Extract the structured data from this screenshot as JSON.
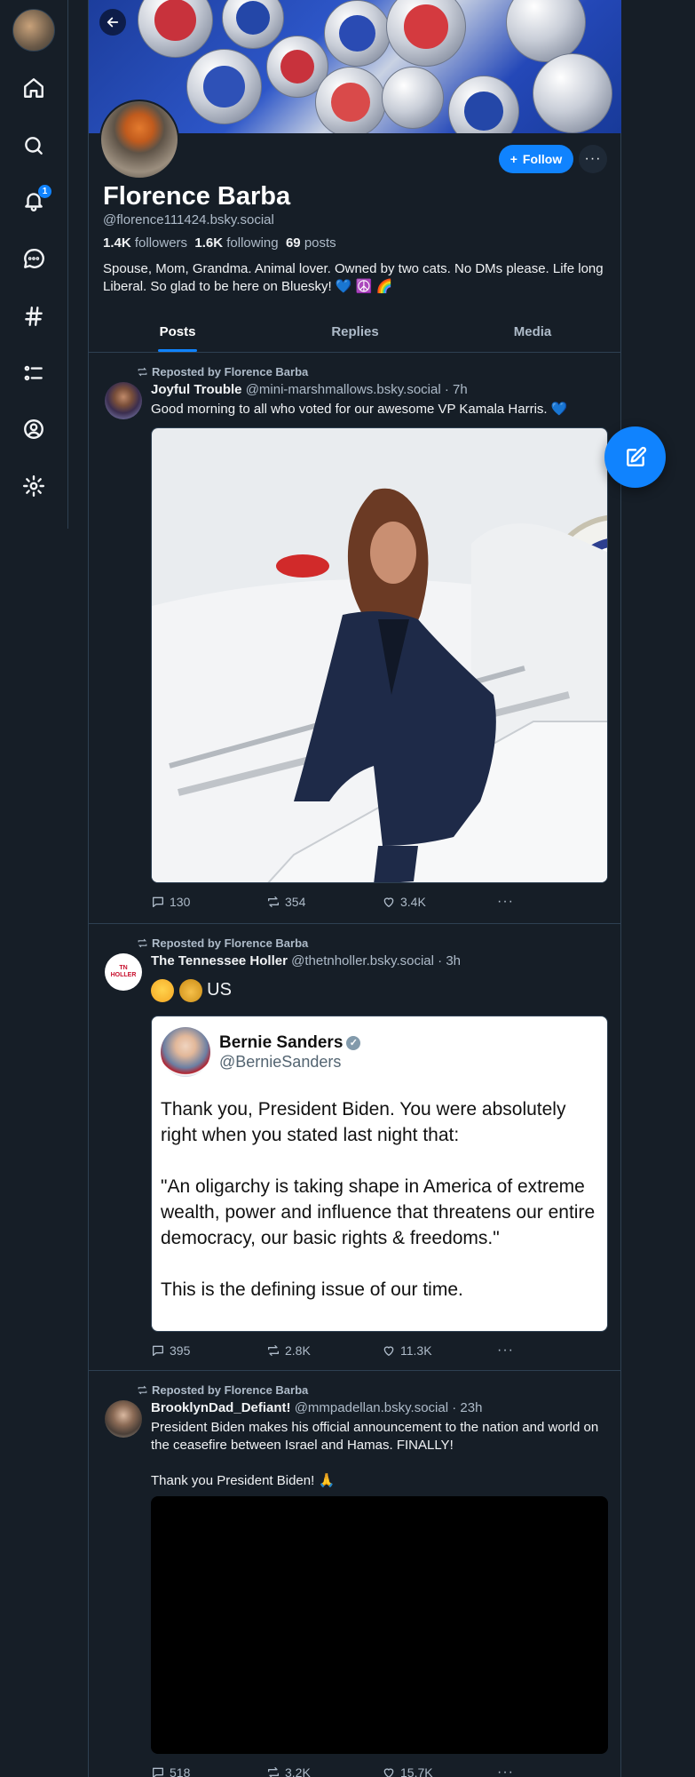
{
  "profile": {
    "name": "Florence Barba",
    "handle": "@florence111424.bsky.social",
    "followers_count": "1.4K",
    "followers_label": "followers",
    "following_count": "1.6K",
    "following_label": "following",
    "posts_count": "69",
    "posts_label": "posts",
    "bio": "Spouse, Mom, Grandma. Animal lover. Owned by two cats. No DMs please. Life long Liberal. So glad to be here on Bluesky! 💙 ☮️ 🌈",
    "follow_label": "Follow",
    "more_label": "···"
  },
  "nav": {
    "notification_badge": "1"
  },
  "tabs": [
    {
      "label": "Posts"
    },
    {
      "label": "Replies"
    },
    {
      "label": "Media"
    }
  ],
  "posts": [
    {
      "repost_label": "Reposted by Florence Barba",
      "author": "Joyful Trouble",
      "handle": "@mini-marshmallows.bsky.social",
      "time": "· 7h",
      "text": "Good morning to all who voted for our awesome VP Kamala Harris. 💙",
      "replies": "130",
      "reposts": "354",
      "likes": "3.4K"
    },
    {
      "repost_label": "Reposted by Florence Barba",
      "author": "The Tennessee Holler",
      "handle": "@thetnholler.bsky.social",
      "time": "· 3h",
      "text": "US",
      "avatar_text": "TN HOLLER",
      "embed": {
        "name": "Bernie Sanders",
        "handle": "@BernieSanders",
        "verified": "✓",
        "p1": "Thank you, President Biden. You were absolutely right when you stated last night that:",
        "p2": "\"An oligarchy is taking shape in America of extreme wealth, power and influence that threatens our entire democracy, our basic rights & freedoms.\"",
        "p3": "This is the defining issue of our time."
      },
      "replies": "395",
      "reposts": "2.8K",
      "likes": "11.3K"
    },
    {
      "repost_label": "Reposted by Florence Barba",
      "author": "BrooklynDad_Defiant!",
      "handle": "@mmpadellan.bsky.social",
      "time": "· 23h",
      "text": "President Biden makes his official announcement to the nation and world on the ceasefire between Israel and Hamas. FINALLY!",
      "text2": "Thank you President Biden! 🙏",
      "replies": "518",
      "reposts": "3.2K",
      "likes": "15.7K"
    }
  ],
  "icons": {
    "home": "home-icon",
    "search": "search-icon",
    "notifications": "bell-icon",
    "chat": "chat-icon",
    "feeds": "hashtag-icon",
    "lists": "list-icon",
    "profile": "user-circle-icon",
    "settings": "gear-icon",
    "compose": "compose-icon"
  },
  "colors": {
    "accent": "#1083fe",
    "background": "#161e27",
    "border": "#2e4052"
  }
}
